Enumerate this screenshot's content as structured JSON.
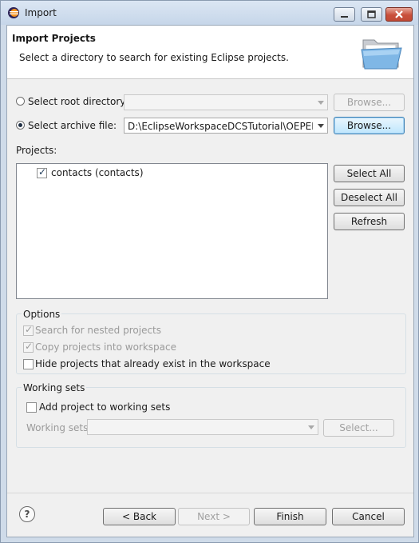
{
  "window": {
    "title": "Import",
    "icon": "eclipse-icon"
  },
  "banner": {
    "title": "Import Projects",
    "description": "Select a directory to search for existing Eclipse projects.",
    "icon": "folder-open-icon"
  },
  "source": {
    "root_directory_label": "Select root directory:",
    "root_directory_value": "",
    "root_browse_label": "Browse...",
    "archive_file_label": "Select archive file:",
    "archive_file_value": "D:\\EclipseWorkspaceDCSTutorial\\OEPEDCST",
    "archive_browse_label": "Browse..."
  },
  "projects": {
    "label": "Projects:",
    "items": [
      {
        "label": "contacts (contacts)",
        "checked": true
      }
    ],
    "select_all_label": "Select All",
    "deselect_all_label": "Deselect All",
    "refresh_label": "Refresh"
  },
  "options": {
    "title": "Options",
    "search_nested": "Search for nested projects",
    "copy_into_workspace": "Copy projects into workspace",
    "hide_existing": "Hide projects that already exist in the workspace"
  },
  "working_sets": {
    "title": "Working sets",
    "add_label": "Add project to working sets",
    "sets_label": "Working sets:",
    "select_label": "Select..."
  },
  "footer": {
    "help_label": "?",
    "back_label": "< Back",
    "next_label": "Next >",
    "finish_label": "Finish",
    "cancel_label": "Cancel"
  }
}
